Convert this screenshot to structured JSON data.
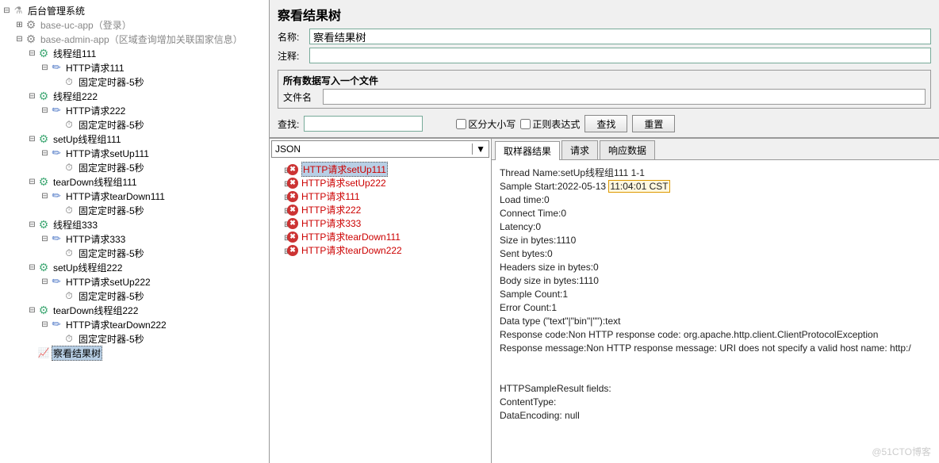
{
  "tree": {
    "root": "后台管理系统",
    "baseUc": "base-uc-app（登录）",
    "baseAdmin": "base-admin-app（区域查询增加关联国家信息）",
    "tg1": "线程组111",
    "tg1_http": "HTTP请求111",
    "tg1_timer": "固定定时器-5秒",
    "tg2": "线程组222",
    "tg2_http": "HTTP请求222",
    "tg2_timer": "固定定时器-5秒",
    "setup1": "setUp线程组111",
    "setup1_http": "HTTP请求setUp111",
    "setup1_timer": "固定定时器-5秒",
    "teardown1": "tearDown线程组111",
    "teardown1_http": "HTTP请求tearDown111",
    "teardown1_timer": "固定定时器-5秒",
    "tg3": "线程组333",
    "tg3_http": "HTTP请求333",
    "tg3_timer": "固定定时器-5秒",
    "setup2": "setUp线程组222",
    "setup2_http": "HTTP请求setUp222",
    "setup2_timer": "固定定时器-5秒",
    "teardown2": "tearDown线程组222",
    "teardown2_http": "HTTP请求tearDown222",
    "teardown2_timer": "固定定时器-5秒",
    "viewResults": "察看结果树"
  },
  "header": {
    "title": "察看结果树",
    "name_label": "名称:",
    "name_value": "察看结果树",
    "notes_label": "注释:",
    "write_section": "所有数据写入一个文件",
    "file_label": "文件名"
  },
  "search": {
    "label": "查找:",
    "case": "区分大小写",
    "regex": "正则表达式",
    "find": "查找",
    "reset": "重置"
  },
  "dropdown": "JSON",
  "results": [
    "HTTP请求setUp111",
    "HTTP请求setUp222",
    "HTTP请求111",
    "HTTP请求222",
    "HTTP请求333",
    "HTTP请求tearDown111",
    "HTTP请求tearDown222"
  ],
  "tabs": {
    "t1": "取样器结果",
    "t2": "请求",
    "t3": "响应数据"
  },
  "detail": {
    "l1a": "Thread Name:setUp线程组111 1-1",
    "l2a": "Sample Start:2022-05-13 ",
    "l2b": "11:04:01 CST",
    "l3": "Load time:0",
    "l4": "Connect Time:0",
    "l5": "Latency:0",
    "l6": "Size in bytes:1110",
    "l7": "Sent bytes:0",
    "l8": "Headers size in bytes:0",
    "l9": "Body size in bytes:1110",
    "l10": "Sample Count:1",
    "l11": "Error Count:1",
    "l12": "Data type (\"text\"|\"bin\"|\"\"):text",
    "l13": "Response code:Non HTTP response code: org.apache.http.client.ClientProtocolException",
    "l14": "Response message:Non HTTP response message: URI does not specify a valid host name: http:/",
    "l15": "HTTPSampleResult fields:",
    "l16": "ContentType:",
    "l17": "DataEncoding: null"
  },
  "watermark": "@51CTO博客"
}
